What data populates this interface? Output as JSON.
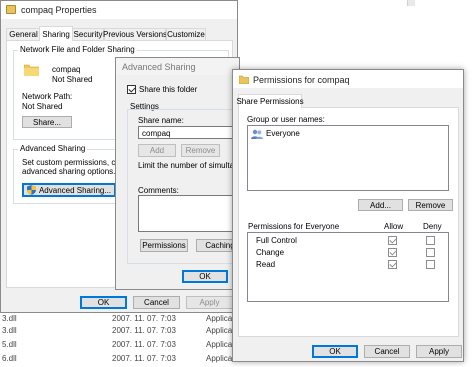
{
  "background_list": {
    "rows": [
      {
        "name": "3.dll",
        "date": "2007. 11. 07. 7:03",
        "type": "Applica"
      },
      {
        "name": "3.dll",
        "date": "2007. 11. 07. 7:03",
        "type": "Applica"
      },
      {
        "name": "5.dll",
        "date": "2007. 11. 07. 7:03",
        "type": "Applica"
      },
      {
        "name": "6.dll",
        "date": "2007. 11. 07. 7:03",
        "type": "Applica"
      }
    ]
  },
  "properties": {
    "title": "compaq Properties",
    "tabs": [
      "General",
      "Sharing",
      "Security",
      "Previous Versions",
      "Customize"
    ],
    "active_tab": "Sharing",
    "nfs_group": "Network File and Folder Sharing",
    "folder_name": "compaq",
    "folder_status": "Not Shared",
    "network_path_label": "Network Path:",
    "network_path_value": "Not Shared",
    "share_button": "Share...",
    "adv_group": "Advanced Sharing",
    "adv_desc_1": "Set custom permissions, create",
    "adv_desc_2": "advanced sharing options.",
    "adv_button": "Advanced Sharing...",
    "ok": "OK",
    "cancel": "Cancel",
    "apply": "Apply"
  },
  "advanced": {
    "title": "Advanced Sharing",
    "share_checkbox": "Share this folder",
    "share_checked": true,
    "settings_group": "Settings",
    "share_name_label": "Share name:",
    "share_name_value": "compaq",
    "add": "Add",
    "remove": "Remove",
    "limit_text": "Limit the number of simultanee",
    "comments_label": "Comments:",
    "permissions_button": "Permissions",
    "caching_button": "Caching",
    "ok": "OK"
  },
  "permissions": {
    "title": "Permissions for compaq",
    "tab": "Share Permissions",
    "group_label": "Group or user names:",
    "users": [
      "Everyone"
    ],
    "add": "Add...",
    "remove": "Remove",
    "perm_header": "Permissions for Everyone",
    "allow_header": "Allow",
    "deny_header": "Deny",
    "rows": [
      {
        "name": "Full Control",
        "allow": true,
        "deny": false
      },
      {
        "name": "Change",
        "allow": true,
        "deny": false
      },
      {
        "name": "Read",
        "allow": true,
        "deny": false
      }
    ],
    "ok": "OK",
    "cancel": "Cancel",
    "apply": "Apply"
  }
}
